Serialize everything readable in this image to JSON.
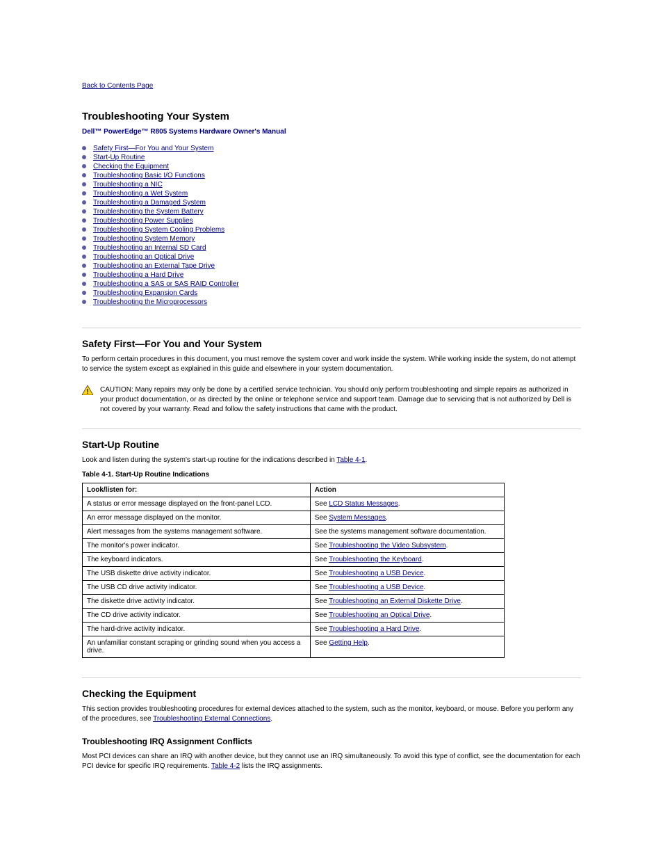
{
  "top_link": "Back to Contents Page",
  "page_title": "Troubleshooting Your System",
  "sub_title": "Dell™ PowerEdge™ R805 Systems Hardware Owner's Manual",
  "toc": [
    "Safety First—For You and Your System",
    "Start-Up Routine",
    "Checking the Equipment",
    "Troubleshooting Basic I/O Functions",
    "Troubleshooting a NIC",
    "Troubleshooting a Wet System",
    "Troubleshooting a Damaged System",
    "Troubleshooting the System Battery",
    "Troubleshooting Power Supplies",
    "Troubleshooting System Cooling Problems",
    "Troubleshooting System Memory",
    "Troubleshooting an Internal SD Card",
    "Troubleshooting an Optical Drive",
    "Troubleshooting an External Tape Drive",
    "Troubleshooting a Hard Drive",
    "Troubleshooting a SAS or SAS RAID Controller",
    "Troubleshooting Expansion Cards",
    "Troubleshooting the Microprocessors"
  ],
  "section1": {
    "title_parts": [
      "Safety First",
      "—",
      "For You and Your System"
    ],
    "para1": "To perform certain procedures in this document, you must remove the system cover and work inside the system. While working inside the system, do not attempt to service the system except as explained in this guide and elsewhere in your system documentation.",
    "caution": "CAUTION: Many repairs may only be done by a certified service technician. You should only perform troubleshooting and simple repairs as authorized in your product documentation, or as directed by the online or telephone service and support team. Damage due to servicing that is not authorized by Dell is not covered by your warranty. Read and follow the safety instructions that came with the product."
  },
  "section2": {
    "title": "Start-Up Routine",
    "para_parts": [
      "Look and listen during the system's start-up routine for the indications described in ",
      "Table 4-1",
      "."
    ],
    "table_caption_parts": [
      "Table 4-1. Start-",
      "Up Routine Indications "
    ],
    "table": {
      "headers": [
        "Look/listen for:",
        "Action"
      ],
      "rows": [
        {
          "c1": "A status or error message displayed on the front-panel LCD.",
          "c2_pre": "See ",
          "c2_link": "LCD Status Messages",
          "c2_post": "."
        },
        {
          "c1": "An error message displayed on the monitor.",
          "c2_pre": "See ",
          "c2_link": "System Messages",
          "c2_post": "."
        },
        {
          "c1": "Alert messages from the systems management software.",
          "c2_pre": "See the systems management software documentation.",
          "c2_link": "",
          "c2_post": ""
        },
        {
          "c1": "The monitor's power indicator.",
          "c2_pre": "See ",
          "c2_link": "Troubleshooting the Video Subsystem",
          "c2_post": "."
        },
        {
          "c1": "The keyboard indicators.",
          "c2_pre": "See ",
          "c2_link": "Troubleshooting the Keyboard",
          "c2_post": "."
        },
        {
          "c1": "The USB diskette drive activity indicator.",
          "c2_pre": "See ",
          "c2_link": "Troubleshooting a USB Device",
          "c2_post": "."
        },
        {
          "c1": "The USB CD drive activity indicator.",
          "c2_pre": "See ",
          "c2_link": "Troubleshooting a USB Device",
          "c2_post": "."
        },
        {
          "c1": "The diskette drive activity indicator.",
          "c2_pre": "See ",
          "c2_link": "Troubleshooting an External Diskette Drive",
          "c2_post": "."
        },
        {
          "c1": "The CD drive activity indicator.",
          "c2_pre": "See ",
          "c2_link": "Troubleshooting an Optical Drive",
          "c2_post": "."
        },
        {
          "c1": "The hard-drive activity indicator.",
          "c2_pre": "See ",
          "c2_link": "Troubleshooting a Hard Drive",
          "c2_post": "."
        },
        {
          "c1": "An unfamiliar constant scraping or grinding sound when you access a drive.",
          "c2_pre": "See ",
          "c2_link": "Getting Help",
          "c2_post": "."
        }
      ]
    }
  },
  "section3": {
    "title": "Checking the Equipment",
    "para1_parts": [
      "This section provides troubleshooting procedures for external devices attached to the system, such as the monitor, keyboard, or mouse. Before you perform any of the procedures, see ",
      "Troubleshooting External Connections",
      "."
    ],
    "sub_title": "Troubleshooting IRQ Assignment Conflicts",
    "para2_parts": [
      "Most PCI devices can share an IRQ with another device, but they cannot use an IRQ simultaneously. To avoid this type of conflict, see the documentation for each PCI device for specific IRQ requirements. ",
      "Table 4-2",
      " lists the IRQ assignments."
    ]
  }
}
